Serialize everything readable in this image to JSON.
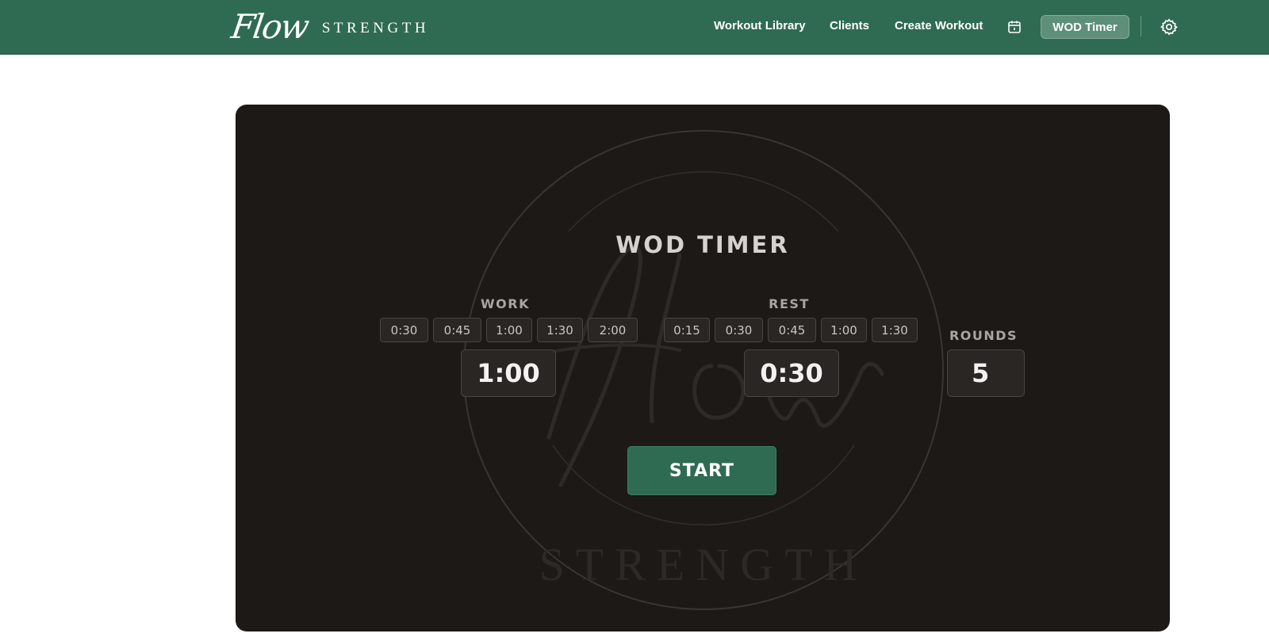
{
  "brand": {
    "script": "Flow",
    "word": "STRENGTH"
  },
  "nav": {
    "workout_library": "Workout Library",
    "clients": "Clients",
    "create_workout": "Create Workout",
    "calendar_icon": "calendar-icon",
    "wod_timer": "WOD Timer",
    "settings_icon": "gear-icon"
  },
  "timer": {
    "title": "WOD TIMER",
    "work": {
      "label": "WORK",
      "presets": [
        "0:30",
        "0:45",
        "1:00",
        "1:30",
        "2:00"
      ],
      "value": "1:00"
    },
    "rest": {
      "label": "REST",
      "presets": [
        "0:15",
        "0:30",
        "0:45",
        "1:00",
        "1:30"
      ],
      "value": "0:30"
    },
    "rounds": {
      "label": "ROUNDS",
      "value": "5"
    },
    "start_label": "START"
  },
  "watermark": {
    "script": "Flow",
    "word": "STRENGTH"
  },
  "colors": {
    "brand_green": "#2f6b52",
    "card_bg": "#1c1917",
    "active_nav": "#5e8f79"
  }
}
